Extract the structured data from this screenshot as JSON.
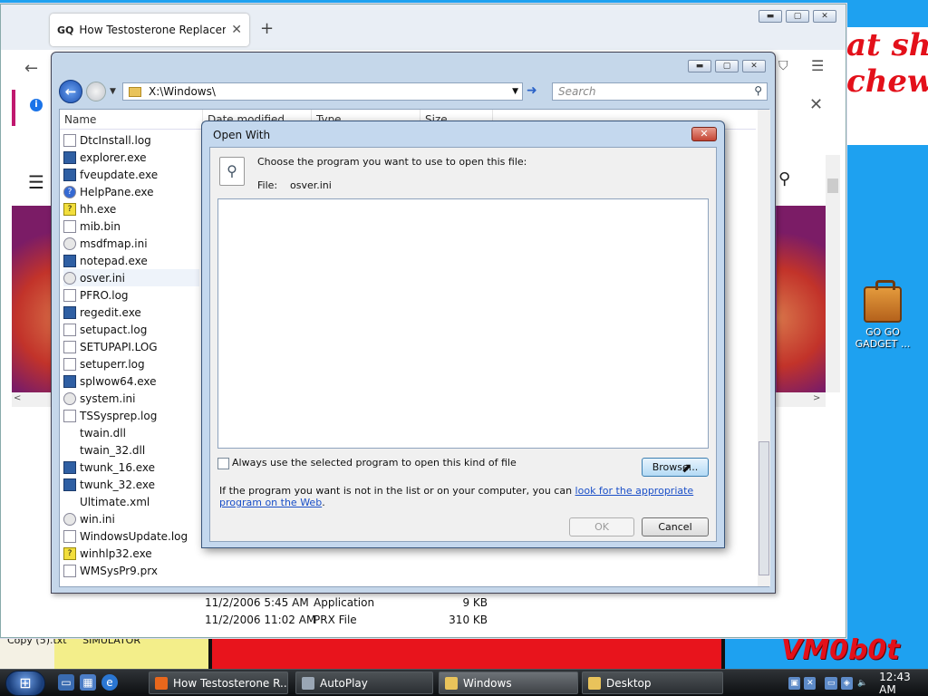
{
  "desktop": {
    "meme_text_line1": "at shit",
    "meme_text_line2": "chew",
    "watermark": "VM0b0t",
    "labels": [
      "Copy (5).txt",
      "SIMULATOR"
    ],
    "gadget_icon_label": "GO GO GADGET ..."
  },
  "firefox": {
    "tab_favicon": "GQ",
    "tab_title": "How Testosterone Replacement",
    "tab_close": "✕",
    "new_tab": "+",
    "info_icon": "i"
  },
  "explorer": {
    "address": "X:\\Windows\\",
    "search_placeholder": "Search",
    "columns": [
      "Name",
      "Date modified",
      "Type",
      "Size"
    ],
    "files": [
      {
        "name": "DtcInstall.log",
        "icon": "file"
      },
      {
        "name": "explorer.exe",
        "icon": "exe"
      },
      {
        "name": "fveupdate.exe",
        "icon": "exe"
      },
      {
        "name": "HelpPane.exe",
        "icon": "help"
      },
      {
        "name": "hh.exe",
        "icon": "q"
      },
      {
        "name": "mib.bin",
        "icon": "file"
      },
      {
        "name": "msdfmap.ini",
        "icon": "ini"
      },
      {
        "name": "notepad.exe",
        "icon": "exe"
      },
      {
        "name": "osver.ini",
        "icon": "ini"
      },
      {
        "name": "PFRO.log",
        "icon": "file"
      },
      {
        "name": "regedit.exe",
        "icon": "exe"
      },
      {
        "name": "setupact.log",
        "icon": "file"
      },
      {
        "name": "SETUPAPI.LOG",
        "icon": "file"
      },
      {
        "name": "setuperr.log",
        "icon": "file"
      },
      {
        "name": "splwow64.exe",
        "icon": "exe"
      },
      {
        "name": "system.ini",
        "icon": "ini"
      },
      {
        "name": "TSSysprep.log",
        "icon": "file"
      },
      {
        "name": "twain.dll",
        "icon": "blank"
      },
      {
        "name": "twain_32.dll",
        "icon": "blank"
      },
      {
        "name": "twunk_16.exe",
        "icon": "exe"
      },
      {
        "name": "twunk_32.exe",
        "icon": "exe"
      },
      {
        "name": "Ultimate.xml",
        "icon": "blank"
      },
      {
        "name": "win.ini",
        "icon": "ini"
      },
      {
        "name": "WindowsUpdate.log",
        "icon": "file"
      },
      {
        "name": "winhlp32.exe",
        "icon": "q"
      },
      {
        "name": "WMSysPr9.prx",
        "icon": "file"
      }
    ],
    "visible_details": [
      {
        "date": "11/2/2006 5:45 AM",
        "type": "Application",
        "size": "9 KB"
      },
      {
        "date": "11/2/2006 11:02 AM",
        "type": "PRX File",
        "size": "310 KB"
      }
    ],
    "selected_index": 8
  },
  "dialog": {
    "title": "Open With",
    "prompt": "Choose the program you want to use to open this file:",
    "file_label": "File:",
    "file_value": "osver.ini",
    "always_use_label": "Always use the selected program to open this kind of file",
    "always_use_checked": false,
    "browse_label": "Browse...",
    "info_text": "If the program you want is not in the list or on your computer, you can ",
    "info_link": "look for the appropriate program on the Web",
    "info_end": ".",
    "ok_label": "OK",
    "cancel_label": "Cancel"
  },
  "taskbar": {
    "buttons": [
      {
        "label": "How Testosterone R...",
        "icon": "firefox-icon",
        "active": false
      },
      {
        "label": "AutoPlay",
        "icon": "autoplay-icon",
        "active": false
      },
      {
        "label": "Windows",
        "icon": "folder-icon",
        "active": true
      },
      {
        "label": "Desktop",
        "icon": "folder-icon",
        "active": false
      }
    ],
    "clock": "12:43 AM"
  },
  "colors": {
    "accent": "#1a4fc8",
    "desktop": "#1ea1f0",
    "meme": "#e3101a"
  }
}
